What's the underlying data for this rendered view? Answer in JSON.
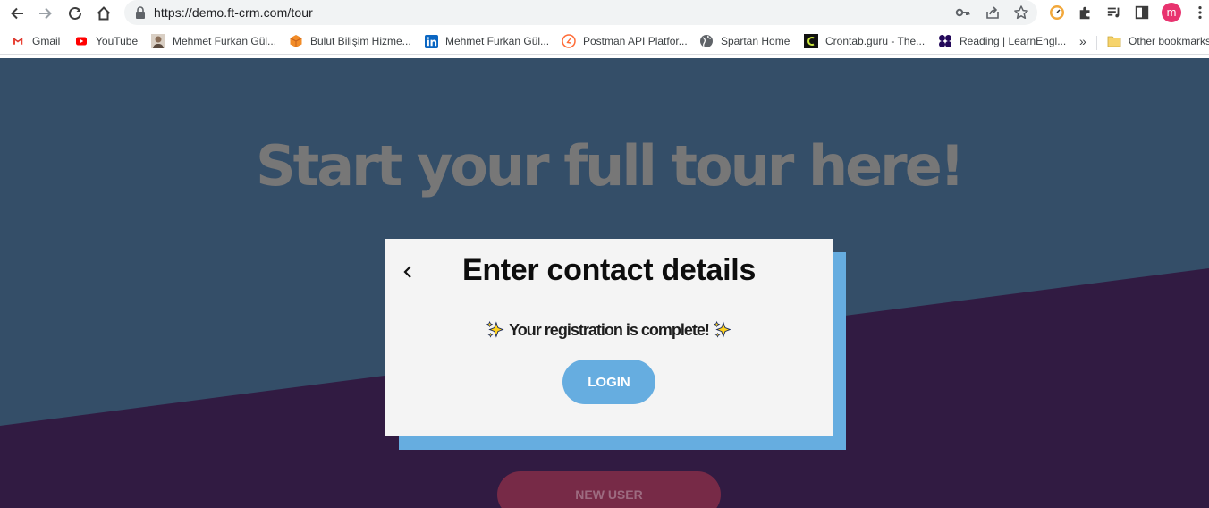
{
  "browser": {
    "url": "https://demo.ft-crm.com/tour",
    "profile_initial": "m",
    "icons": {
      "back": "arrow-left-icon",
      "forward": "arrow-right-icon",
      "reload": "reload-icon",
      "home": "home-icon",
      "lock": "lock-icon",
      "key": "key-icon",
      "share": "share-icon",
      "star": "star-icon",
      "extension": "puzzle-icon",
      "reading_list": "reading-list-icon",
      "side_panel": "side-panel-icon",
      "menu": "kebab-menu-icon"
    }
  },
  "bookmarks": {
    "items": [
      {
        "label": "Gmail",
        "icon": "gmail-icon"
      },
      {
        "label": "YouTube",
        "icon": "youtube-icon"
      },
      {
        "label": "Mehmet Furkan Gül...",
        "icon": "avatar-icon"
      },
      {
        "label": "Bulut Bilişim Hizme...",
        "icon": "cube-icon"
      },
      {
        "label": "Mehmet Furkan Gül...",
        "icon": "linkedin-icon"
      },
      {
        "label": "Postman API Platfor...",
        "icon": "postman-icon"
      },
      {
        "label": "Spartan Home",
        "icon": "globe-icon"
      },
      {
        "label": "Crontab.guru - The...",
        "icon": "crontab-icon"
      },
      {
        "label": "Reading | LearnEngl...",
        "icon": "reading-icon"
      }
    ],
    "overflow_label": "»",
    "other_label": "Other bookmarks"
  },
  "page": {
    "heading": "Start your full tour here!",
    "card": {
      "title": "Enter contact details",
      "message": "Your registration is complete!",
      "login_label": "LOGIN"
    },
    "new_user_label": "NEW USER"
  },
  "colors": {
    "background_top": "#344e68",
    "background_bottom": "#311b42",
    "card_accent": "#66ade0",
    "new_user_button": "#772a47"
  }
}
